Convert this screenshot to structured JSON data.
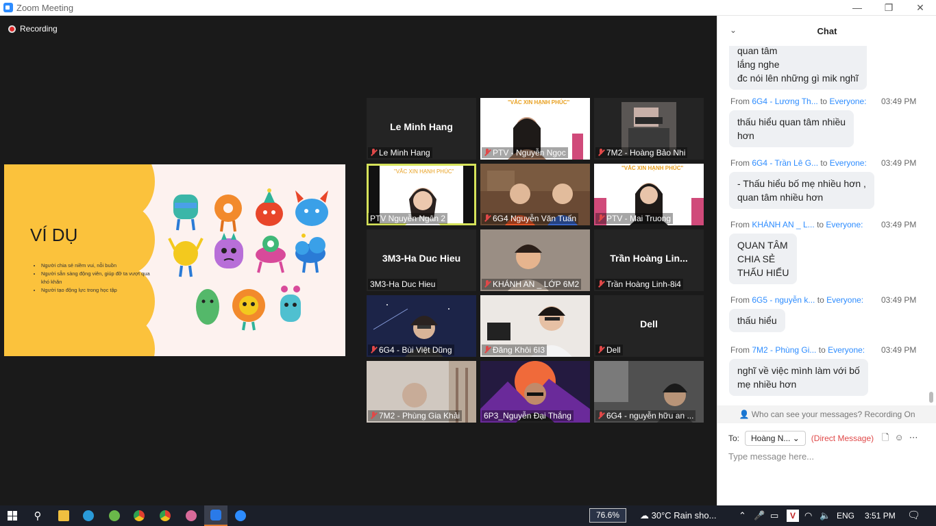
{
  "window": {
    "title": "Zoom Meeting",
    "recording": "Recording"
  },
  "slide": {
    "heading": "VÍ DỤ",
    "bullets": [
      "Người chia sẻ niềm vui, nỗi buồn",
      "Người sẵn sàng động viên, giúp đỡ ta vượt qua khó khăn",
      "Người tạo động lực trong học tập"
    ]
  },
  "banner_text": "\"VẮC XIN HẠNH PHÚC\"",
  "tiles": [
    {
      "name": "Le Minh Hang",
      "big": "Le Minh Hang",
      "muted": true
    },
    {
      "name": "PTV - Nguyễn Ngọc",
      "muted": true
    },
    {
      "name": "7M2 - Hoàng Bảo Nhi",
      "muted": true
    },
    {
      "name": "PTV Nguyễn Ngân 2",
      "muted": false
    },
    {
      "name": "6G4 Nguyễn Văn Tuấn",
      "muted": true
    },
    {
      "name": "PTV - Mai Truong",
      "muted": true
    },
    {
      "name": "3M3-Ha Duc Hieu",
      "big": "3M3-Ha Duc Hieu",
      "muted": false
    },
    {
      "name": "KHÁNH AN _ LỚP 6M2",
      "muted": true
    },
    {
      "name": "Trần Hoàng Linh-8i4",
      "big": "Trần Hoàng Lin...",
      "muted": true
    },
    {
      "name": "6G4 - Bùi Việt Dũng",
      "muted": true
    },
    {
      "name": "Đăng Khôi 6I3",
      "muted": true
    },
    {
      "name": "Dell",
      "big": "Dell",
      "muted": true
    },
    {
      "name": "7M2 - Phùng Gia Khải",
      "muted": true
    },
    {
      "name": "6P3_Nguyễn Đại Thắng",
      "muted": false
    },
    {
      "name": "6G4 - nguyễn hữu an ...",
      "muted": true
    }
  ],
  "chat": {
    "title": "Chat",
    "first_bubble": [
      "quan tâm",
      "lắng nghe",
      "đc nói lên những gì mik nghĩ"
    ],
    "messages": [
      {
        "from": "6G4 - Lương Th...",
        "to": "Everyone:",
        "time": "03:49 PM",
        "text": [
          "thấu hiểu  quan tâm nhiều",
          "hơn"
        ]
      },
      {
        "from": "6G4 - Trần Lê G...",
        "to": "Everyone:",
        "time": "03:49 PM",
        "text": [
          "- Thấu hiểu bố mẹ nhiều hơn ,",
          "quan tâm nhiều hơn"
        ]
      },
      {
        "from": "KHÁNH AN _ L...",
        "to": "Everyone:",
        "time": "03:49 PM",
        "text": [
          "QUAN TÂM",
          "CHIA SẺ",
          "THẤU HIỂU"
        ]
      },
      {
        "from": "6G5 - nguyễn k...",
        "to": "Everyone:",
        "time": "03:49 PM",
        "text": [
          "thấu hiểu"
        ]
      },
      {
        "from": "7M2 - Phùng Gi...",
        "to": "Everyone:",
        "time": "03:49 PM",
        "text": [
          "nghĩ về việc mình làm với bố",
          "mẹ nhiều hơn"
        ]
      }
    ],
    "from_label": "From",
    "to_label": "to",
    "who_can_see": "Who can see your messages? Recording On",
    "to_field": "To:",
    "recipient": "Hoàng N... ⌄",
    "direct": "(Direct Message)",
    "placeholder": "Type message here..."
  },
  "taskbar": {
    "zoom": "76.6%",
    "weather": "30°C  Rain sho...",
    "lang": "ENG",
    "clock": "3:51 PM"
  }
}
